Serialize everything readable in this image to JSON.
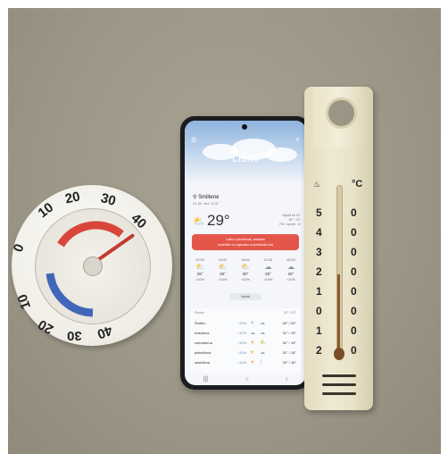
{
  "dial": {
    "numbers": [
      "10",
      "20",
      "30",
      "40",
      "0",
      "10",
      "20",
      "30",
      "40"
    ]
  },
  "phone": {
    "app_title": "Laiks",
    "location": "Smiltene",
    "location_sub": "24. jūl., otrd. 12:37",
    "current_temp": "29°",
    "current_detail": [
      "Sajūta kā 32°",
      "30° / 20°",
      "PM / apmēr. 12"
    ],
    "alert": [
      "Laiks ir piesārņots, iesakām",
      "izvairīties no ilgstošas uzturēšanās ārā"
    ],
    "hourly": [
      {
        "time": "12:30",
        "temp": "29°",
        "pct": "<10%"
      },
      {
        "time": "15:00",
        "temp": "30°",
        "pct": "<10%"
      },
      {
        "time": "18:00",
        "temp": "30°",
        "pct": "<10%"
      },
      {
        "time": "21:00",
        "temp": "25°",
        "pct": "<10%"
      },
      {
        "time": "00:00",
        "temp": "25°",
        "pct": "<10%"
      }
    ],
    "more_label": "Vairāk",
    "daily_header_left": "Šodien",
    "daily_header_right": "30° / 20°",
    "daily": [
      {
        "day": "Šodien",
        "pct": "<10%",
        "range": "30° / 20°"
      },
      {
        "day": "trešdiena",
        "pct": "<10%",
        "range": "31° / 19°"
      },
      {
        "day": "ceturtdiena",
        "pct": "<10%",
        "range": "32° / 19°"
      },
      {
        "day": "piektdiena",
        "pct": "<10%",
        "range": "31° / 18°"
      },
      {
        "day": "sestdiena",
        "pct": "<10%",
        "range": "29° / 16°"
      }
    ]
  },
  "wall": {
    "unit": "°C",
    "scale_left": [
      "5",
      "4",
      "3",
      "2",
      "1",
      "0",
      "1",
      "2"
    ],
    "scale_right": [
      "0",
      "0",
      "0",
      "0",
      "0",
      "0",
      "0",
      "0"
    ]
  }
}
